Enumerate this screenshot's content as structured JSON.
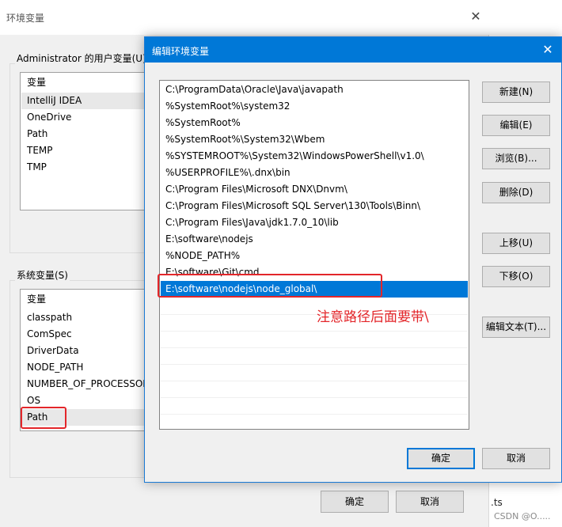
{
  "background_window": {
    "title": "环境变量",
    "user_vars": {
      "group_label": "Administrator 的用户变量(U)",
      "header": "变量",
      "items": [
        "IntelliJ IDEA",
        "OneDrive",
        "Path",
        "TEMP",
        "TMP"
      ]
    },
    "system_vars": {
      "group_label": "系统变量(S)",
      "header": "变量",
      "items": [
        "classpath",
        "ComSpec",
        "DriverData",
        "NODE_PATH",
        "NUMBER_OF_PROCESSOR",
        "OS",
        "Path"
      ]
    },
    "ok_label": "确定",
    "cancel_label": "取消"
  },
  "edit_dialog": {
    "title": "编辑环境变量",
    "paths": [
      "C:\\ProgramData\\Oracle\\Java\\javapath",
      "%SystemRoot%\\system32",
      "%SystemRoot%",
      "%SystemRoot%\\System32\\Wbem",
      "%SYSTEMROOT%\\System32\\WindowsPowerShell\\v1.0\\",
      "%USERPROFILE%\\.dnx\\bin",
      "C:\\Program Files\\Microsoft DNX\\Dnvm\\",
      "C:\\Program Files\\Microsoft SQL Server\\130\\Tools\\Binn\\",
      "C:\\Program Files\\Java\\jdk1.7.0_10\\lib",
      "E:\\software\\nodejs",
      "%NODE_PATH%",
      "E:\\software\\Git\\cmd",
      "E:\\software\\nodejs\\node_global\\"
    ],
    "selected_index": 12,
    "buttons": {
      "new": "新建(N)",
      "edit": "编辑(E)",
      "browse": "浏览(B)...",
      "delete": "删除(D)",
      "move_up": "上移(U)",
      "move_down": "下移(O)",
      "edit_text": "编辑文本(T)..."
    },
    "ok_label": "确定",
    "cancel_label": "取消"
  },
  "annotation": {
    "text": "注意路径后面要带\\",
    "color": "#e3262a"
  },
  "side_text": ".ts",
  "watermark": "CSDN @O.....",
  "colors": {
    "accent": "#0078d7",
    "window_bg": "#f0f0f0"
  }
}
